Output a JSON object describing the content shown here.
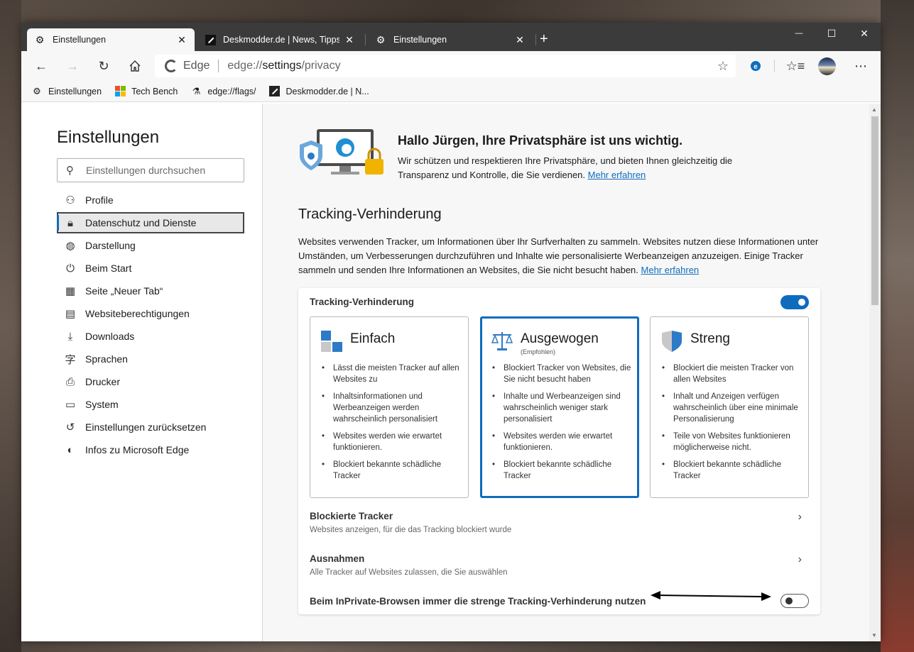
{
  "tabs": [
    {
      "label": "Einstellungen",
      "close": "✕"
    },
    {
      "label": "Deskmodder.de | News, Tipps ur",
      "close": "✕"
    },
    {
      "label": "Einstellungen",
      "close": "✕"
    }
  ],
  "newtab": "+",
  "window_controls": {
    "minimize": "—",
    "maximize": "☐",
    "close": "✕"
  },
  "address": {
    "brand": "Edge",
    "url_prefix": "edge://",
    "url_bold": "settings",
    "url_suffix": "/privacy"
  },
  "favorites": [
    {
      "label": "Einstellungen",
      "icon": "gear-icon"
    },
    {
      "label": "Tech Bench",
      "icon": "microsoft-logo-icon"
    },
    {
      "label": "edge://flags/",
      "icon": "flask-icon"
    },
    {
      "label": "Deskmodder.de | N...",
      "icon": "deskmodder-icon"
    }
  ],
  "sidebar": {
    "title": "Einstellungen",
    "search_placeholder": "Einstellungen durchsuchen",
    "items": [
      {
        "label": "Profile",
        "icon": "person-icon",
        "glyph": "⚇"
      },
      {
        "label": "Datenschutz und Dienste",
        "icon": "lock-icon",
        "glyph": "🔒︎",
        "active": true
      },
      {
        "label": "Darstellung",
        "icon": "palette-icon",
        "glyph": "◍"
      },
      {
        "label": "Beim Start",
        "icon": "power-icon",
        "glyph": "⏻"
      },
      {
        "label": "Seite „Neuer Tab“",
        "icon": "newtab-page-icon",
        "glyph": "▦"
      },
      {
        "label": "Websiteberechtigungen",
        "icon": "site-permissions-icon",
        "glyph": "▤"
      },
      {
        "label": "Downloads",
        "icon": "download-icon",
        "glyph": "⤓"
      },
      {
        "label": "Sprachen",
        "icon": "language-icon",
        "glyph": "字"
      },
      {
        "label": "Drucker",
        "icon": "printer-icon",
        "glyph": "⎙"
      },
      {
        "label": "System",
        "icon": "laptop-icon",
        "glyph": "▭"
      },
      {
        "label": "Einstellungen zurücksetzen",
        "icon": "reset-icon",
        "glyph": "↺"
      },
      {
        "label": "Infos zu Microsoft Edge",
        "icon": "edge-icon",
        "glyph": "◐"
      }
    ]
  },
  "hero": {
    "title": "Hallo Jürgen, Ihre Privatsphäre ist uns wichtig.",
    "text": "Wir schützen und respektieren Ihre Privatsphäre, und bieten Ihnen gleichzeitig die Transparenz und Kontrolle, die Sie verdienen.",
    "link": "Mehr erfahren"
  },
  "tracking": {
    "title": "Tracking-Verhinderung",
    "description": "Websites verwenden Tracker, um Informationen über Ihr Surfverhalten zu sammeln. Websites nutzen diese Informationen unter Umständen, um Verbesserungen durchzuführen und Inhalte wie personalisierte Werbeanzeigen anzuzeigen. Einige Tracker sammeln und senden Ihre Informationen an Websites, die Sie nicht besucht haben.",
    "link": "Mehr erfahren",
    "card_title": "Tracking-Verhinderung",
    "enabled": true,
    "levels": [
      {
        "title": "Einfach",
        "subtitle": "",
        "bullets": [
          "Lässt die meisten Tracker auf allen Websites zu",
          "Inhaltsinformationen und Werbeanzeigen werden wahrscheinlich personalisiert",
          "Websites werden wie erwartet funktionieren.",
          "Blockiert bekannte schädliche Tracker"
        ]
      },
      {
        "title": "Ausgewogen",
        "subtitle": "(Empfohlen)",
        "selected": true,
        "bullets": [
          "Blockiert Tracker von Websites, die Sie nicht besucht haben",
          "Inhalte und Werbeanzeigen sind wahrscheinlich weniger stark personalisiert",
          "Websites werden wie erwartet funktionieren.",
          "Blockiert bekannte schädliche Tracker"
        ]
      },
      {
        "title": "Streng",
        "subtitle": "",
        "bullets": [
          "Blockiert die meisten Tracker von allen Websites",
          "Inhalt und Anzeigen verfügen wahrscheinlich über eine minimale Personalisierung",
          "Teile von Websites funktionieren möglicherweise nicht.",
          "Blockiert bekannte schädliche Tracker"
        ]
      }
    ],
    "blocked": {
      "title": "Blockierte Tracker",
      "subtitle": "Websites anzeigen, für die das Tracking blockiert wurde"
    },
    "exceptions": {
      "title": "Ausnahmen",
      "subtitle": "Alle Tracker auf Websites zulassen, die Sie auswählen"
    },
    "inprivate": {
      "title": "Beim InPrivate-Browsen immer die strenge Tracking-Verhinderung nutzen",
      "enabled": false
    }
  },
  "colors": {
    "accent": "#0f6cbd",
    "tab_bar": "#3b3b3b"
  }
}
